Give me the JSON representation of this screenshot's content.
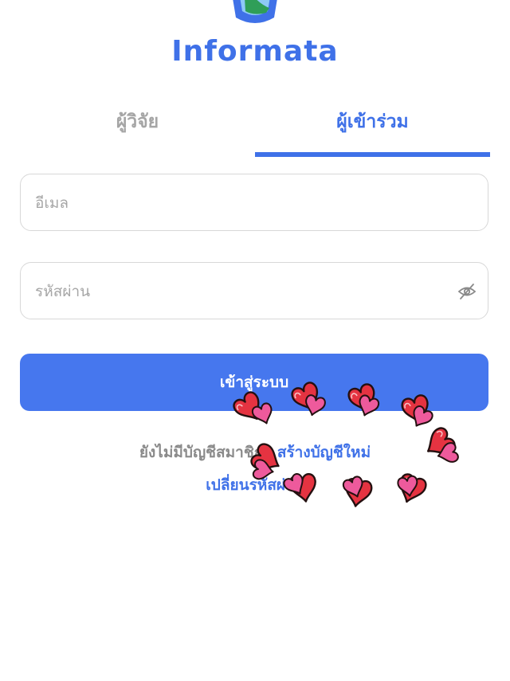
{
  "brand": {
    "name": "Informata",
    "color": "#3f71e8"
  },
  "tabs": [
    {
      "label": "ผู้วิจัย",
      "active": false
    },
    {
      "label": "ผู้เข้าร่วม",
      "active": true
    }
  ],
  "form": {
    "email_placeholder": "อีเมล",
    "password_placeholder": "รหัสผ่าน",
    "submit_label": "เข้าสู่ระบบ"
  },
  "footer": {
    "signup_prompt": "ยังไม่มีบัญชีสมาชิก?",
    "signup_link": "สร้างบัญชีใหม่",
    "forgot_link": "เปลี่ยนรหัสผ่าน"
  },
  "colors": {
    "accent": "#3f71e8",
    "button": "#4677ee",
    "inactive_tab": "#a5a5a5",
    "heart_red": "#e53341",
    "heart_pink": "#ee5a9c"
  },
  "icons": {
    "logo": "informata-logo-icon",
    "password_toggle": "eye-off-icon",
    "decoration": "hearts-sticker"
  }
}
